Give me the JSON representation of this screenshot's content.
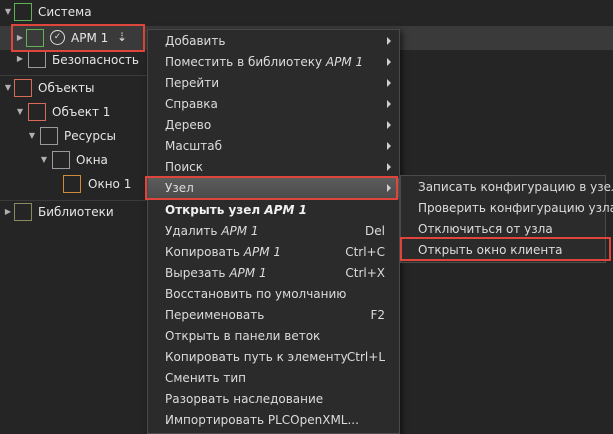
{
  "tree": {
    "system": "Система",
    "arm": "АРМ 1",
    "security": "Безопасность",
    "objects": "Объекты",
    "object1": "Объект 1",
    "resources": "Ресурсы",
    "windows": "Окна",
    "window1": "Окно 1",
    "libraries": "Библиотеки"
  },
  "menu": {
    "add": "Добавить",
    "put_lib_prefix": "Поместить в библиотеку ",
    "put_lib_target": "АРМ 1",
    "goto": "Перейти",
    "help": "Справка",
    "tree": "Дерево",
    "scale": "Масштаб",
    "search": "Поиск",
    "node": "Узел",
    "open_node_prefix": "Открыть узел ",
    "open_node_target": "АРМ 1",
    "delete_prefix": "Удалить ",
    "delete_target": "АРМ 1",
    "delete_sc": "Del",
    "copy_prefix": "Копировать ",
    "copy_target": "АРМ 1",
    "copy_sc": "Ctrl+C",
    "cut_prefix": "Вырезать ",
    "cut_target": "АРМ 1",
    "cut_sc": "Ctrl+X",
    "restore": "Восстановить по умолчанию",
    "rename": "Переименовать",
    "rename_sc": "F2",
    "open_branch": "Открыть в панели веток",
    "copy_path": "Копировать путь к элементу",
    "copy_path_sc": "Ctrl+L",
    "change_type": "Сменить тип",
    "break_inherit": "Разорвать наследование",
    "import_plc": "Импортировать PLCOpenXML..."
  },
  "submenu": {
    "write_config": "Записать конфигурацию в узел",
    "check_config": "Проверить конфигурацию узла",
    "disconnect": "Отключиться от узла",
    "open_client": "Открыть окно клиента"
  },
  "colors": {
    "highlight_box": "#e0453c",
    "background": "#252526",
    "menu_bg": "#2b2b2b"
  }
}
